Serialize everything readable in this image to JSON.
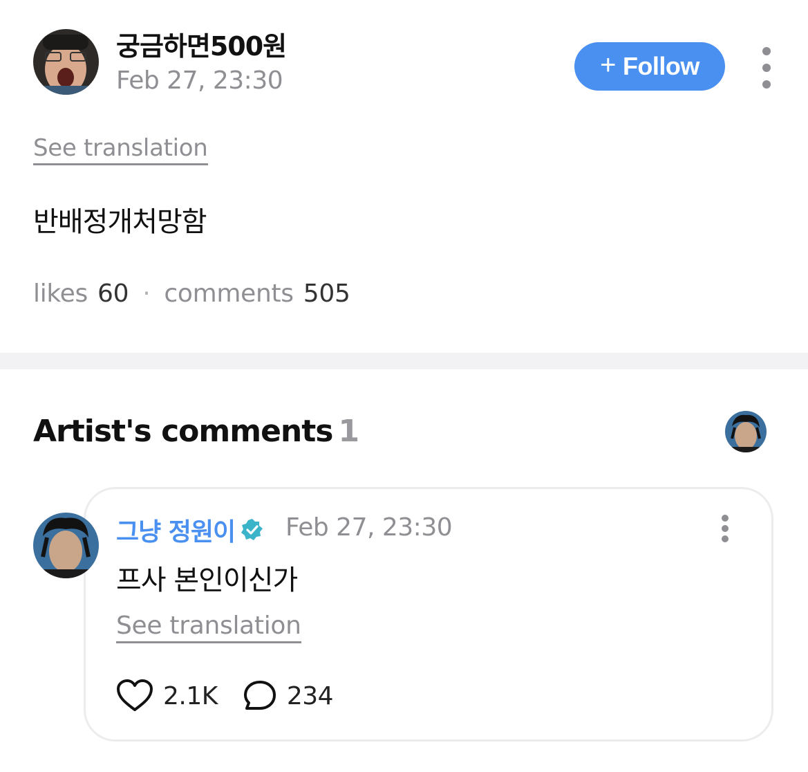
{
  "post": {
    "author_name": "궁금하면500원",
    "date": "Feb 27, 23:30",
    "follow_label": "Follow",
    "follow_icon": "plus-icon",
    "see_translation": "See translation",
    "body": "반배정개처망함",
    "likes_label": "likes",
    "likes_count": "60",
    "separator": "·",
    "comments_label": "comments",
    "comments_count": "505"
  },
  "artist_comments": {
    "title": "Artist's comments",
    "count": "1",
    "comment": {
      "author_name": "그냥 정원이",
      "verified_icon": "verified-badge-icon",
      "date": "Feb 27, 23:30",
      "body": "프사 본인이신가",
      "see_translation": "See translation",
      "like_count": "2.1K",
      "reply_count": "234"
    }
  },
  "colors": {
    "accent": "#4a90f0",
    "muted": "#8e8e93",
    "divider": "#f2f2f4",
    "verified": "#3bb3c9"
  }
}
